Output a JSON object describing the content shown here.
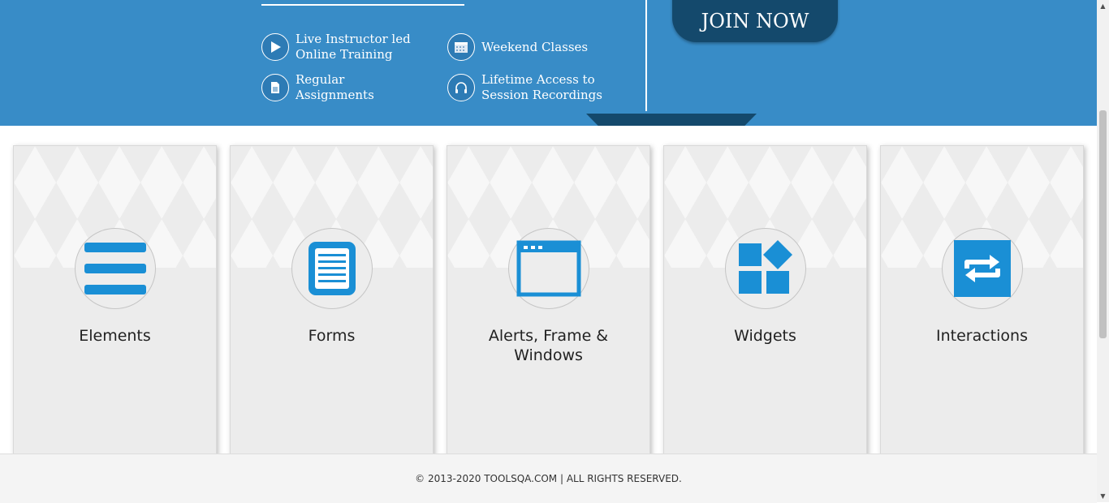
{
  "banner": {
    "features": [
      {
        "label": "Live Instructor led\nOnline Training",
        "icon": "play-icon"
      },
      {
        "label": "Weekend Classes",
        "icon": "calendar-icon"
      },
      {
        "label": "Regular\nAssignments",
        "icon": "document-icon"
      },
      {
        "label": "Lifetime Access to\nSession Recordings",
        "icon": "headphones-icon"
      }
    ],
    "join_label": "JOIN NOW",
    "color": "#388cc7",
    "accent_dark": "#14496c"
  },
  "cards": [
    {
      "title": "Elements",
      "icon": "hamburger-menu-icon"
    },
    {
      "title": "Forms",
      "icon": "form-document-icon"
    },
    {
      "title": "Alerts, Frame & Windows",
      "icon": "browser-window-icon"
    },
    {
      "title": "Widgets",
      "icon": "widgets-grid-icon"
    },
    {
      "title": "Interactions",
      "icon": "swap-arrows-icon"
    }
  ],
  "card_icon_color": "#1a8fd5",
  "footer": {
    "text": "© 2013-2020 TOOLSQA.COM | ALL RIGHTS RESERVED."
  }
}
